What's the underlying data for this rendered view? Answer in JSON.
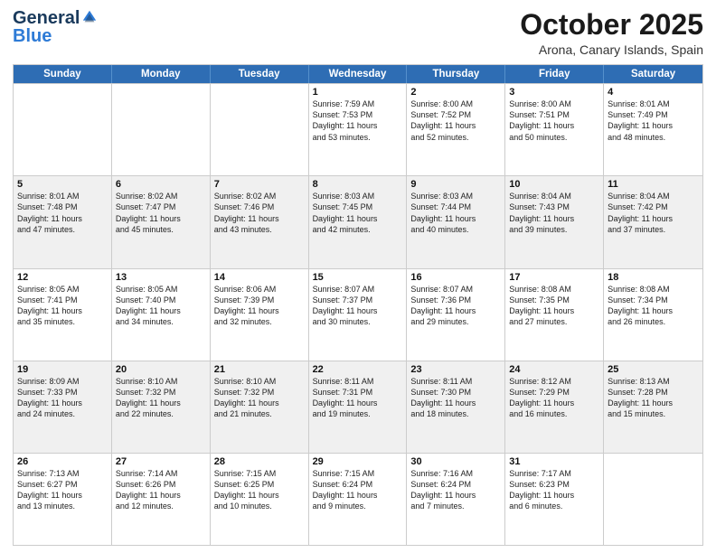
{
  "header": {
    "logo_general": "General",
    "logo_blue": "Blue",
    "month_title": "October 2025",
    "location": "Arona, Canary Islands, Spain"
  },
  "days_of_week": [
    "Sunday",
    "Monday",
    "Tuesday",
    "Wednesday",
    "Thursday",
    "Friday",
    "Saturday"
  ],
  "weeks": [
    [
      {
        "day": "",
        "lines": []
      },
      {
        "day": "",
        "lines": []
      },
      {
        "day": "",
        "lines": []
      },
      {
        "day": "1",
        "lines": [
          "Sunrise: 7:59 AM",
          "Sunset: 7:53 PM",
          "Daylight: 11 hours",
          "and 53 minutes."
        ]
      },
      {
        "day": "2",
        "lines": [
          "Sunrise: 8:00 AM",
          "Sunset: 7:52 PM",
          "Daylight: 11 hours",
          "and 52 minutes."
        ]
      },
      {
        "day": "3",
        "lines": [
          "Sunrise: 8:00 AM",
          "Sunset: 7:51 PM",
          "Daylight: 11 hours",
          "and 50 minutes."
        ]
      },
      {
        "day": "4",
        "lines": [
          "Sunrise: 8:01 AM",
          "Sunset: 7:49 PM",
          "Daylight: 11 hours",
          "and 48 minutes."
        ]
      }
    ],
    [
      {
        "day": "5",
        "lines": [
          "Sunrise: 8:01 AM",
          "Sunset: 7:48 PM",
          "Daylight: 11 hours",
          "and 47 minutes."
        ]
      },
      {
        "day": "6",
        "lines": [
          "Sunrise: 8:02 AM",
          "Sunset: 7:47 PM",
          "Daylight: 11 hours",
          "and 45 minutes."
        ]
      },
      {
        "day": "7",
        "lines": [
          "Sunrise: 8:02 AM",
          "Sunset: 7:46 PM",
          "Daylight: 11 hours",
          "and 43 minutes."
        ]
      },
      {
        "day": "8",
        "lines": [
          "Sunrise: 8:03 AM",
          "Sunset: 7:45 PM",
          "Daylight: 11 hours",
          "and 42 minutes."
        ]
      },
      {
        "day": "9",
        "lines": [
          "Sunrise: 8:03 AM",
          "Sunset: 7:44 PM",
          "Daylight: 11 hours",
          "and 40 minutes."
        ]
      },
      {
        "day": "10",
        "lines": [
          "Sunrise: 8:04 AM",
          "Sunset: 7:43 PM",
          "Daylight: 11 hours",
          "and 39 minutes."
        ]
      },
      {
        "day": "11",
        "lines": [
          "Sunrise: 8:04 AM",
          "Sunset: 7:42 PM",
          "Daylight: 11 hours",
          "and 37 minutes."
        ]
      }
    ],
    [
      {
        "day": "12",
        "lines": [
          "Sunrise: 8:05 AM",
          "Sunset: 7:41 PM",
          "Daylight: 11 hours",
          "and 35 minutes."
        ]
      },
      {
        "day": "13",
        "lines": [
          "Sunrise: 8:05 AM",
          "Sunset: 7:40 PM",
          "Daylight: 11 hours",
          "and 34 minutes."
        ]
      },
      {
        "day": "14",
        "lines": [
          "Sunrise: 8:06 AM",
          "Sunset: 7:39 PM",
          "Daylight: 11 hours",
          "and 32 minutes."
        ]
      },
      {
        "day": "15",
        "lines": [
          "Sunrise: 8:07 AM",
          "Sunset: 7:37 PM",
          "Daylight: 11 hours",
          "and 30 minutes."
        ]
      },
      {
        "day": "16",
        "lines": [
          "Sunrise: 8:07 AM",
          "Sunset: 7:36 PM",
          "Daylight: 11 hours",
          "and 29 minutes."
        ]
      },
      {
        "day": "17",
        "lines": [
          "Sunrise: 8:08 AM",
          "Sunset: 7:35 PM",
          "Daylight: 11 hours",
          "and 27 minutes."
        ]
      },
      {
        "day": "18",
        "lines": [
          "Sunrise: 8:08 AM",
          "Sunset: 7:34 PM",
          "Daylight: 11 hours",
          "and 26 minutes."
        ]
      }
    ],
    [
      {
        "day": "19",
        "lines": [
          "Sunrise: 8:09 AM",
          "Sunset: 7:33 PM",
          "Daylight: 11 hours",
          "and 24 minutes."
        ]
      },
      {
        "day": "20",
        "lines": [
          "Sunrise: 8:10 AM",
          "Sunset: 7:32 PM",
          "Daylight: 11 hours",
          "and 22 minutes."
        ]
      },
      {
        "day": "21",
        "lines": [
          "Sunrise: 8:10 AM",
          "Sunset: 7:32 PM",
          "Daylight: 11 hours",
          "and 21 minutes."
        ]
      },
      {
        "day": "22",
        "lines": [
          "Sunrise: 8:11 AM",
          "Sunset: 7:31 PM",
          "Daylight: 11 hours",
          "and 19 minutes."
        ]
      },
      {
        "day": "23",
        "lines": [
          "Sunrise: 8:11 AM",
          "Sunset: 7:30 PM",
          "Daylight: 11 hours",
          "and 18 minutes."
        ]
      },
      {
        "day": "24",
        "lines": [
          "Sunrise: 8:12 AM",
          "Sunset: 7:29 PM",
          "Daylight: 11 hours",
          "and 16 minutes."
        ]
      },
      {
        "day": "25",
        "lines": [
          "Sunrise: 8:13 AM",
          "Sunset: 7:28 PM",
          "Daylight: 11 hours",
          "and 15 minutes."
        ]
      }
    ],
    [
      {
        "day": "26",
        "lines": [
          "Sunrise: 7:13 AM",
          "Sunset: 6:27 PM",
          "Daylight: 11 hours",
          "and 13 minutes."
        ]
      },
      {
        "day": "27",
        "lines": [
          "Sunrise: 7:14 AM",
          "Sunset: 6:26 PM",
          "Daylight: 11 hours",
          "and 12 minutes."
        ]
      },
      {
        "day": "28",
        "lines": [
          "Sunrise: 7:15 AM",
          "Sunset: 6:25 PM",
          "Daylight: 11 hours",
          "and 10 minutes."
        ]
      },
      {
        "day": "29",
        "lines": [
          "Sunrise: 7:15 AM",
          "Sunset: 6:24 PM",
          "Daylight: 11 hours",
          "and 9 minutes."
        ]
      },
      {
        "day": "30",
        "lines": [
          "Sunrise: 7:16 AM",
          "Sunset: 6:24 PM",
          "Daylight: 11 hours",
          "and 7 minutes."
        ]
      },
      {
        "day": "31",
        "lines": [
          "Sunrise: 7:17 AM",
          "Sunset: 6:23 PM",
          "Daylight: 11 hours",
          "and 6 minutes."
        ]
      },
      {
        "day": "",
        "lines": []
      }
    ]
  ]
}
